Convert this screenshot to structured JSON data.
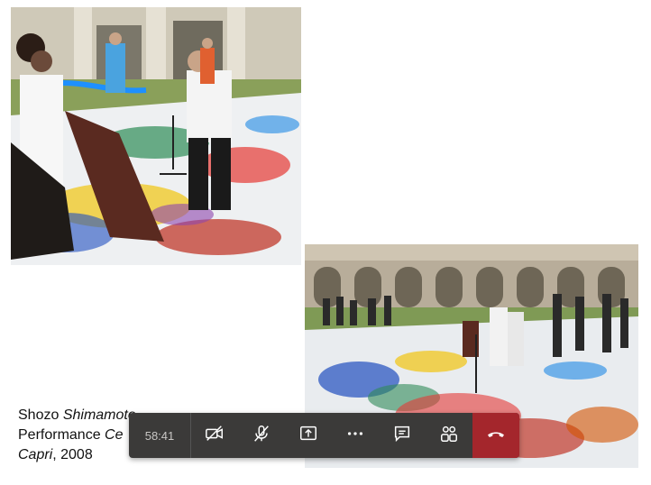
{
  "caption": {
    "artist_first": "Shozo ",
    "artist_last": "Shimamoto",
    "line2_prefix": "Performance ",
    "line2_italic": "Ce",
    "line3_italic": "Capri",
    "line3_suffix": ", 2008"
  },
  "callbar": {
    "timer": "58:41",
    "controls": [
      {
        "name": "camera-off-icon"
      },
      {
        "name": "mic-off-icon"
      },
      {
        "name": "share-screen-icon"
      },
      {
        "name": "more-options-icon"
      },
      {
        "name": "chat-icon"
      },
      {
        "name": "participants-icon"
      },
      {
        "name": "hang-up-icon"
      }
    ],
    "hangup_color": "#a4262c"
  }
}
